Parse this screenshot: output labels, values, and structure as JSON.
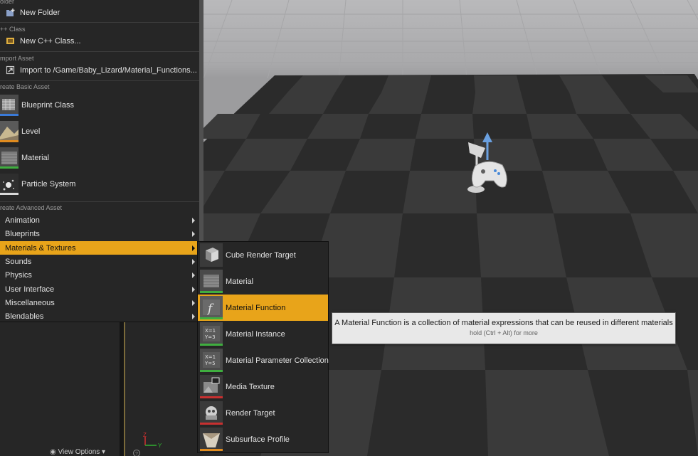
{
  "menu": {
    "folder_header": "older",
    "new_folder": "New Folder",
    "cpp_header": "++ Class",
    "new_cpp_class": "New C++ Class...",
    "import_header": "mport Asset",
    "import_to": "Import to /Game/Baby_Lizard/Material_Functions...",
    "basic_header": "reate Basic Asset",
    "basic_items": [
      "Blueprint Class",
      "Level",
      "Material",
      "Particle System"
    ],
    "advanced_header": "reate Advanced Asset",
    "advanced_items": [
      "Animation",
      "Blueprints",
      "Materials & Textures",
      "Sounds",
      "Physics",
      "User Interface",
      "Miscellaneous",
      "Blendables"
    ],
    "active_item": "Materials & Textures"
  },
  "submenu": {
    "items": [
      "Cube Render Target",
      "Material",
      "Material Function",
      "Material Instance",
      "Material Parameter Collection",
      "Media Texture",
      "Render Target",
      "Subsurface Profile"
    ],
    "active_item": "Material Function"
  },
  "tooltip": {
    "text": "A Material Function is a collection of material expressions that can be reused in different materials",
    "hint": "hold (Ctrl + Alt) for more"
  },
  "bottom_bar": {
    "view_options": "View Options ▾"
  },
  "colors": {
    "accent": "#e8a41a",
    "menu_bg": "#262626",
    "blueprint_bar": "#3a7ad8",
    "level_bar": "#e08c20",
    "material_bar": "#3fae3f",
    "particle_bar": "#d8d8d8",
    "media_bar": "#c83030"
  }
}
